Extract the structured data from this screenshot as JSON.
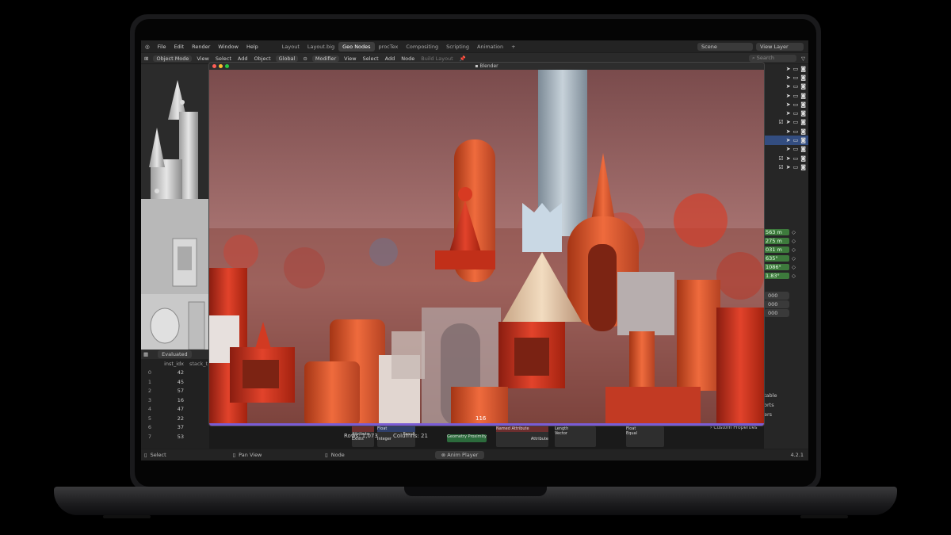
{
  "menu": {
    "items": [
      "File",
      "Edit",
      "Render",
      "Window",
      "Help"
    ],
    "tabs": [
      "Layout",
      "Layout.big",
      "Geo Nodes",
      "procTex",
      "Compositing",
      "Scripting",
      "Animation"
    ],
    "active_tab": "Geo Nodes",
    "add_tab": "+",
    "scene": "Scene",
    "view_layer": "View Layer"
  },
  "toolbar": {
    "mode": "Object Mode",
    "view": "View",
    "select": "Select",
    "add": "Add",
    "object": "Object",
    "orientation": "Global",
    "modifier": "Modifier",
    "node_view": "View",
    "node_select": "Select",
    "node_add": "Add",
    "node": "Node",
    "build_layout": "Build Layout",
    "search_placeholder": "Search"
  },
  "render_window": {
    "title": "Blender",
    "frame": "116"
  },
  "spreadsheet": {
    "mode": "Evaluated",
    "columns": [
      "inst_idx",
      "stack_t"
    ],
    "rows": [
      {
        "i": "0",
        "v": "42"
      },
      {
        "i": "1",
        "v": "45"
      },
      {
        "i": "2",
        "v": "57"
      },
      {
        "i": "3",
        "v": "16"
      },
      {
        "i": "4",
        "v": "47"
      },
      {
        "i": "5",
        "v": "22"
      },
      {
        "i": "6",
        "v": "37"
      },
      {
        "i": "7",
        "v": "53"
      }
    ],
    "rows_label": "Rows: 1,073",
    "columns_label": "Columns: 21"
  },
  "properties": {
    "values": [
      "563 m",
      "275 m",
      "031 m",
      "635°",
      "1086°",
      "1.83°"
    ],
    "gray_values": [
      "000",
      "000",
      "000"
    ],
    "labels": [
      "table",
      "orts",
      "ers"
    ],
    "custom_properties": "Custom Properties"
  },
  "nodes": {
    "items": [
      "Attribute",
      "Exists",
      "Float",
      "Integer",
      "Result",
      "Geometry Proximity",
      "Named Attribute",
      "Attribute",
      "Length",
      "Vector",
      "Float",
      "Equal"
    ]
  },
  "status": {
    "select": "Select",
    "pan_view": "Pan View",
    "node": "Node",
    "anim_player": "Anim Player",
    "version": "4.2.1"
  },
  "colors": {
    "accent_blue": "#334d80",
    "play_purple": "#7a5cd6",
    "green_field": "#3d7a3c"
  }
}
